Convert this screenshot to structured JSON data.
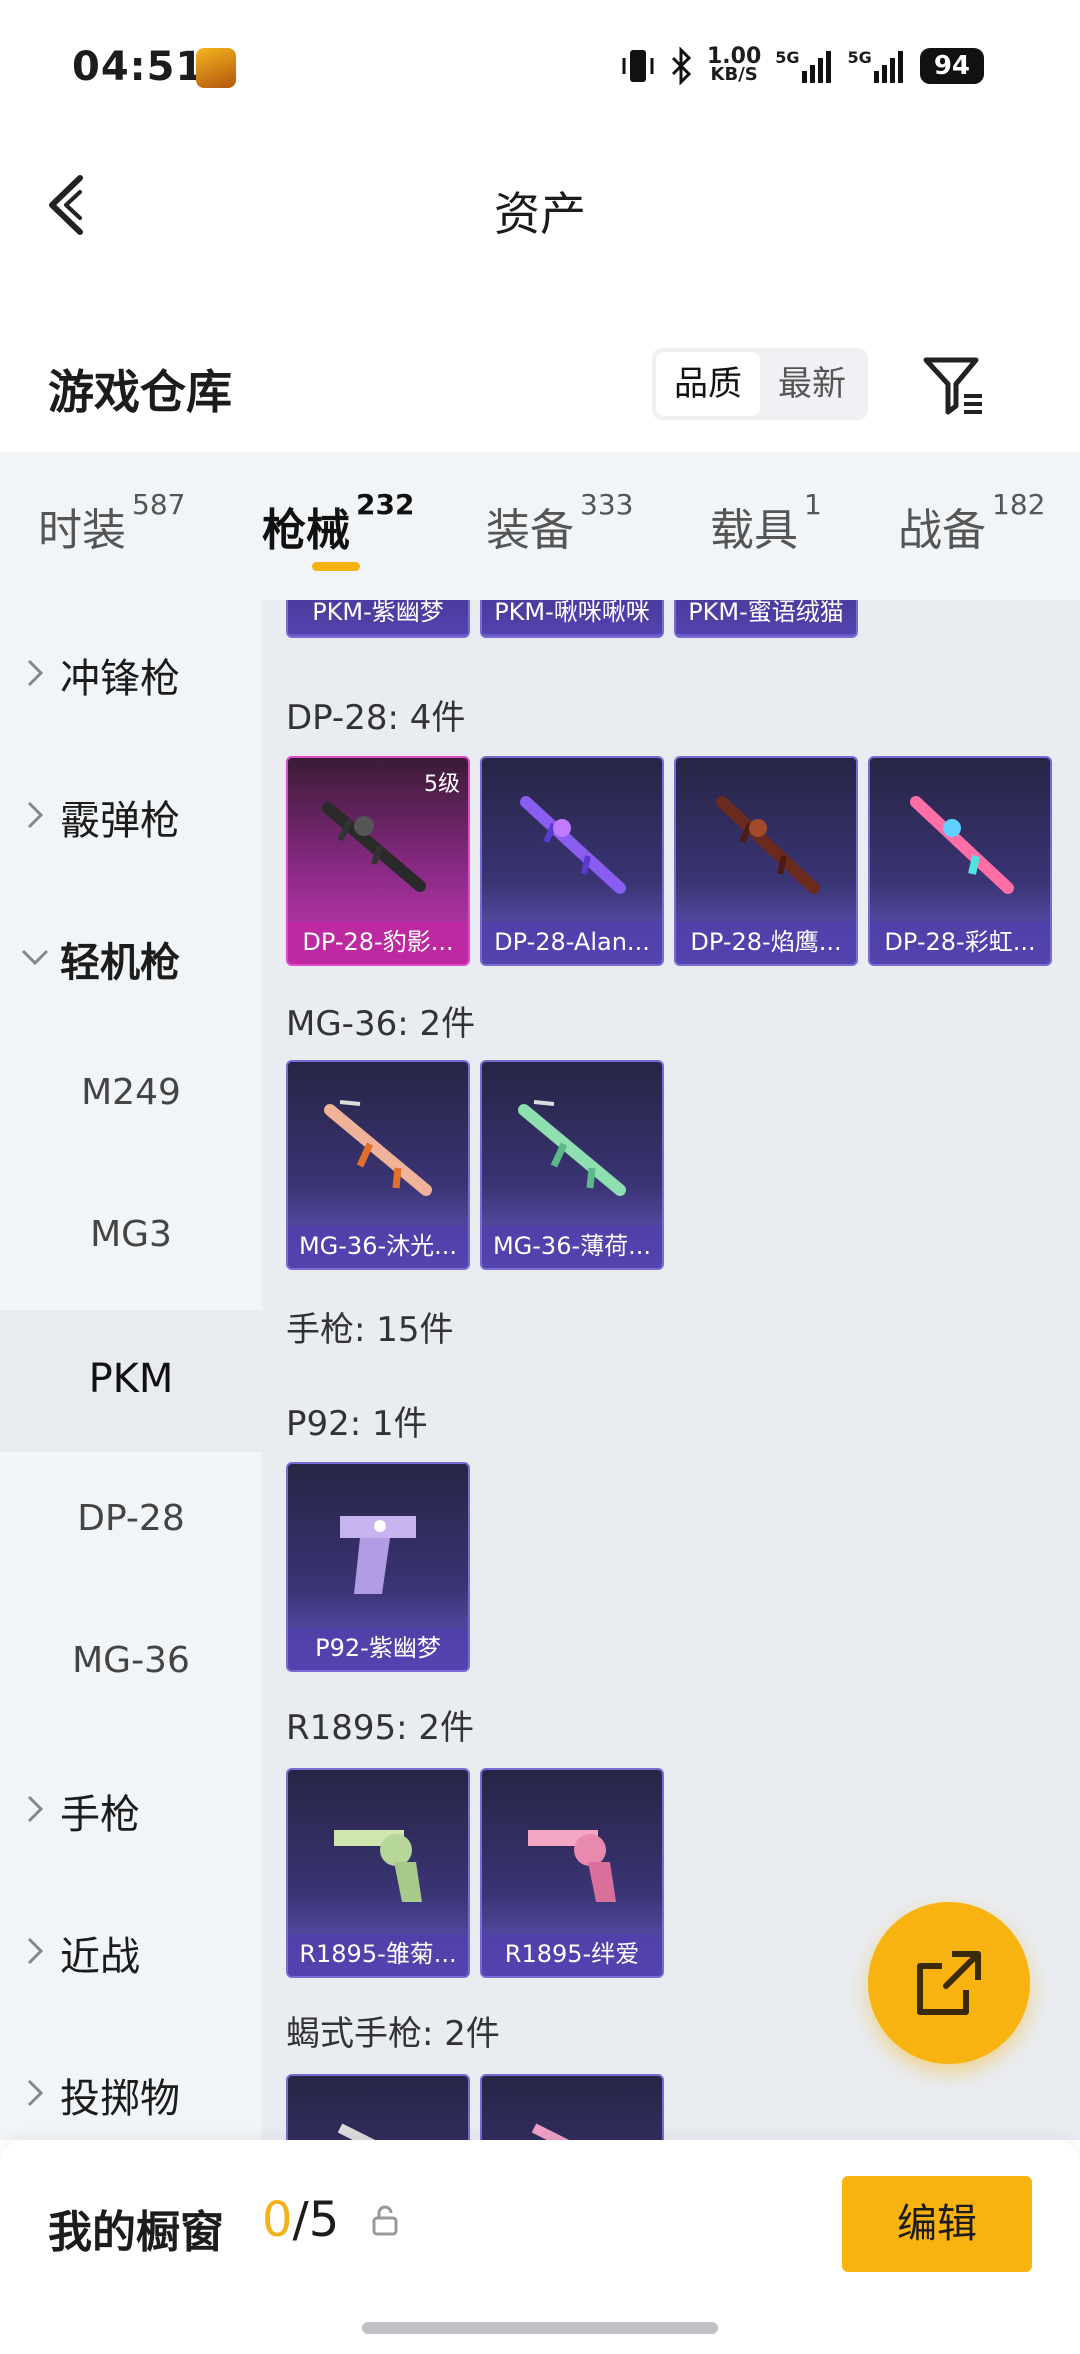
{
  "status_bar": {
    "time": "04:51",
    "net_speed_value": "1.00",
    "net_speed_unit": "KB/S",
    "signal1_label": "5G",
    "signal2_label": "5G",
    "battery": "94"
  },
  "header": {
    "title": "资产"
  },
  "warehouse": {
    "title": "游戏仓库",
    "sort_options": [
      "品质",
      "最新"
    ],
    "sort_active": "品质"
  },
  "tabs": [
    {
      "label": "时装",
      "count": "587"
    },
    {
      "label": "枪械",
      "count": "232"
    },
    {
      "label": "装备",
      "count": "333"
    },
    {
      "label": "载具",
      "count": "1"
    },
    {
      "label": "战备",
      "count": "182"
    }
  ],
  "active_tab": "枪械",
  "sidebar": {
    "items": [
      {
        "label": "冲锋枪"
      },
      {
        "label": "霰弹枪"
      },
      {
        "label": "轻机枪"
      },
      {
        "label": "M249"
      },
      {
        "label": "MG3"
      },
      {
        "label": "PKM"
      },
      {
        "label": "DP-28"
      },
      {
        "label": "MG-36"
      },
      {
        "label": "手枪"
      },
      {
        "label": "近战"
      },
      {
        "label": "投掷物"
      }
    ],
    "selected": "PKM"
  },
  "content": {
    "top_row": [
      "PKM-紫幽梦",
      "PKM-啾咪啾咪",
      "PKM-蜜语绒猫"
    ],
    "groups": [
      {
        "title": "DP-28: 4件",
        "items": [
          {
            "name": "DP-28-豹影...",
            "level": "5级"
          },
          {
            "name": "DP-28-Alan..."
          },
          {
            "name": "DP-28-焰鹰..."
          },
          {
            "name": "DP-28-彩虹..."
          }
        ]
      },
      {
        "title": "MG-36: 2件",
        "items": [
          {
            "name": "MG-36-沐光..."
          },
          {
            "name": "MG-36-薄荷..."
          }
        ]
      },
      {
        "title": "手枪: 15件",
        "items": []
      },
      {
        "title": "P92: 1件",
        "items": [
          {
            "name": "P92-紫幽梦"
          }
        ]
      },
      {
        "title": "R1895: 2件",
        "items": [
          {
            "name": "R1895-雏菊..."
          },
          {
            "name": "R1895-绊爱"
          }
        ]
      },
      {
        "title": "蝎式手枪: 2件",
        "items": []
      }
    ]
  },
  "bottom": {
    "title": "我的橱窗",
    "count_current": "0",
    "count_sep": "/",
    "count_total": "5",
    "edit_label": "编辑"
  }
}
